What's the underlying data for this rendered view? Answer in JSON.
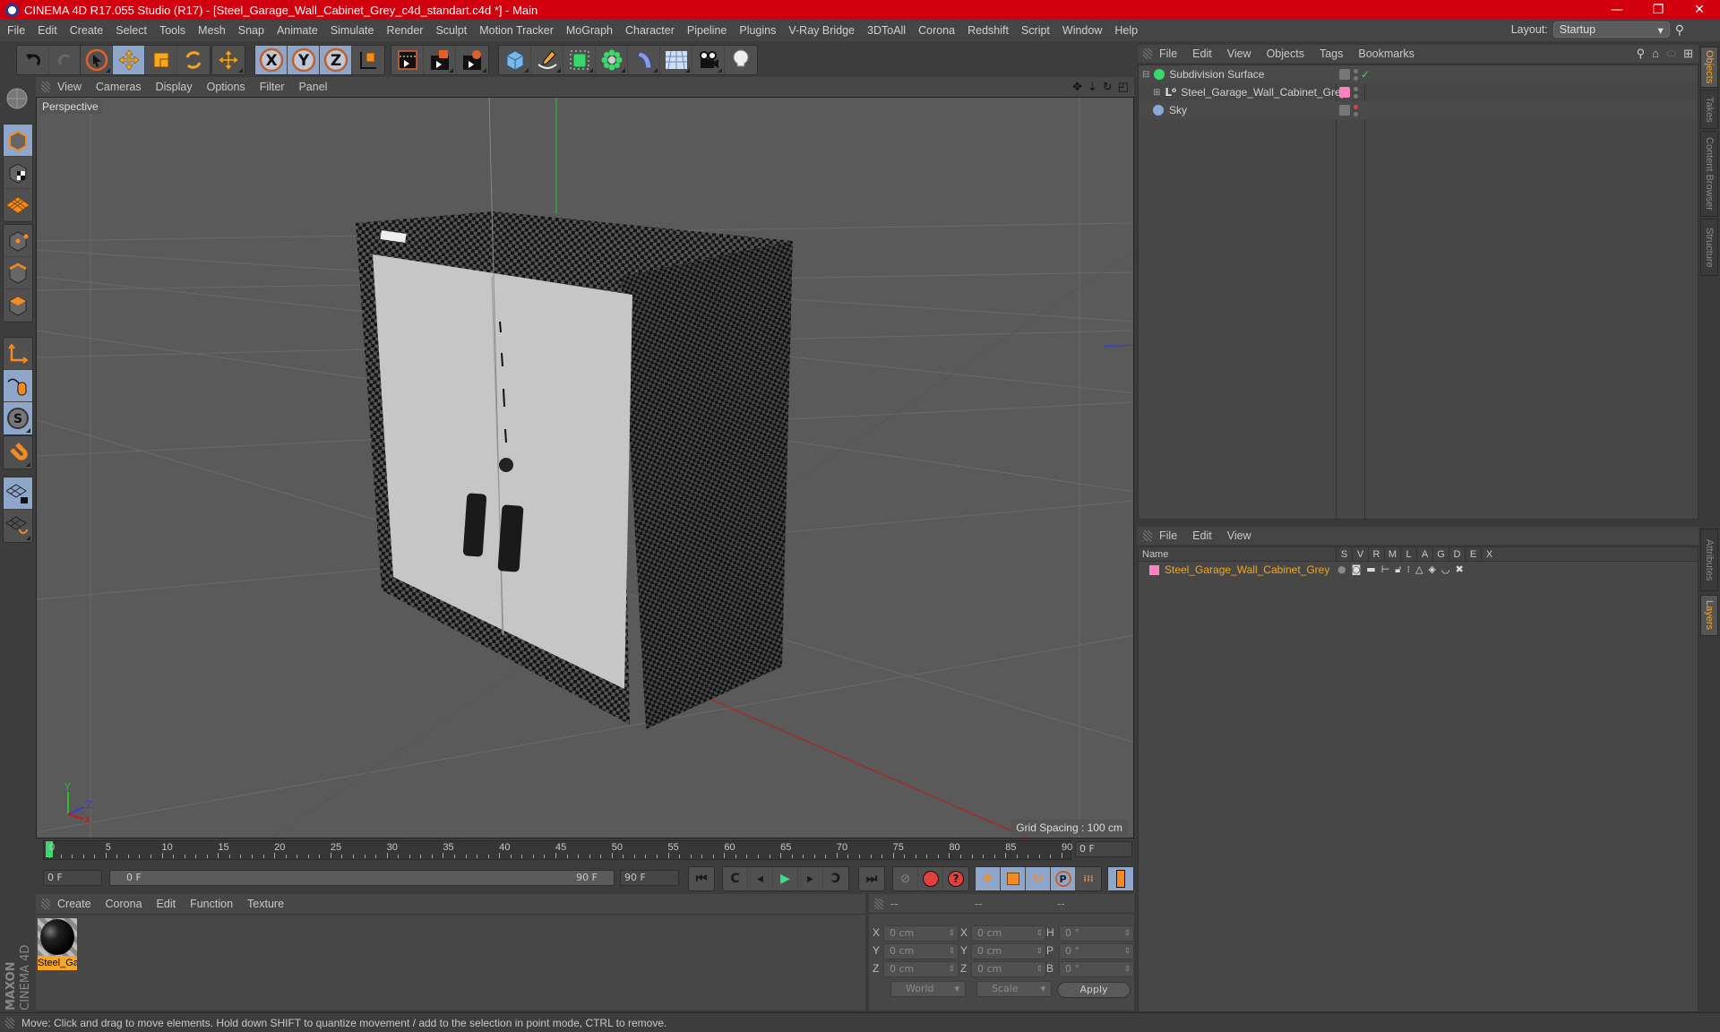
{
  "window": {
    "title": "CINEMA 4D R17.055 Studio (R17) - [Steel_Garage_Wall_Cabinet_Grey_c4d_standart.c4d *] - Main",
    "controls": [
      "minimize-icon",
      "maximize-icon",
      "close-icon"
    ]
  },
  "menubar": {
    "items": [
      "File",
      "Edit",
      "Create",
      "Select",
      "Tools",
      "Mesh",
      "Snap",
      "Animate",
      "Simulate",
      "Render",
      "Sculpt",
      "Motion Tracker",
      "MoGraph",
      "Character",
      "Pipeline",
      "Plugins",
      "V-Ray Bridge",
      "3DToAll",
      "Corona",
      "Redshift",
      "Script",
      "Window",
      "Help"
    ],
    "layout_label": "Layout:",
    "layout_value": "Startup"
  },
  "toolbar": {
    "groups": [
      [
        "undo-icon",
        "redo-icon"
      ],
      [
        "select-icon",
        "move-icon",
        "scale-icon",
        "rotate-icon"
      ],
      [
        "move-last-icon"
      ],
      [
        "x-axis-icon",
        "y-axis-icon",
        "z-axis-icon",
        "coordinate-system-icon"
      ],
      [
        "render-view-icon",
        "render-picture-viewer-icon",
        "render-settings-icon"
      ],
      [
        "cube-icon",
        "pen-icon",
        "subdivision-icon",
        "cloner-icon",
        "deformer-icon",
        "floor-icon",
        "camera-icon",
        "light-icon"
      ]
    ]
  },
  "left_tools": [
    "workplane-icon",
    "model-mode-icon",
    "texture-mode-icon",
    "workplane-grid-icon",
    "points-mode-icon",
    "edges-mode-icon",
    "polygons-mode-icon",
    "axis-icon",
    "tweak-icon",
    "soft-selection-icon",
    "snap-magnet-icon",
    "lock-workplane-icon",
    "workplane-rotate-icon"
  ],
  "viewport": {
    "menu": [
      "View",
      "Cameras",
      "Display",
      "Options",
      "Filter",
      "Panel"
    ],
    "nav_icons": [
      "pan-icon",
      "zoom-icon",
      "orbit-icon",
      "maximize-view-icon"
    ],
    "label": "Perspective",
    "grid_spacing": "Grid Spacing : 100 cm",
    "axis_labels": {
      "x": "X",
      "y": "Y",
      "z": "Z"
    }
  },
  "timeline": {
    "ticks": [
      0,
      5,
      10,
      15,
      20,
      25,
      30,
      35,
      40,
      45,
      50,
      55,
      60,
      65,
      70,
      75,
      80,
      85,
      90
    ],
    "current_frame": "0 F",
    "start_field": "0 F",
    "range_start": "0 F",
    "range_end": "90 F",
    "end_field": "90 F"
  },
  "transport": {
    "buttons": [
      "go-to-start-icon",
      "previous-key-icon",
      "step-back-icon",
      "play-icon",
      "step-forward-icon",
      "next-key-icon",
      "go-to-end-icon"
    ],
    "record": [
      "keyframe-selection-icon",
      "autokey-icon",
      "record-help-icon"
    ],
    "key_types": [
      "key-position-icon",
      "key-scale-icon",
      "key-rotation-icon",
      "key-parameter-icon",
      "key-point-level-icon"
    ],
    "timeline_icon": "timeline-icon"
  },
  "material_manager": {
    "menu": [
      "Create",
      "Corona",
      "Edit",
      "Function",
      "Texture"
    ],
    "materials": [
      {
        "name": "Steel_Ga"
      }
    ]
  },
  "coordinates": {
    "headers": [
      "--",
      "--",
      "--"
    ],
    "position": [
      {
        "axis": "X",
        "value": "0 cm"
      },
      {
        "axis": "Y",
        "value": "0 cm"
      },
      {
        "axis": "Z",
        "value": "0 cm"
      }
    ],
    "size": [
      {
        "axis": "X",
        "value": "0 cm"
      },
      {
        "axis": "Y",
        "value": "0 cm"
      },
      {
        "axis": "Z",
        "value": "0 cm"
      }
    ],
    "rotation": [
      {
        "axis": "H",
        "value": "0 °"
      },
      {
        "axis": "P",
        "value": "0 °"
      },
      {
        "axis": "B",
        "value": "0 °"
      }
    ],
    "space_dropdown": "World",
    "mode_dropdown": "Scale",
    "apply_label": "Apply"
  },
  "object_manager": {
    "menu": [
      "File",
      "Edit",
      "View",
      "Objects",
      "Tags",
      "Bookmarks"
    ],
    "objects": [
      {
        "name": "Subdivision Surface",
        "icon": "subdivision-surface-icon",
        "tag": "gray",
        "enabled": "check"
      },
      {
        "name": "Steel_Garage_Wall_Cabinet_Grey",
        "icon": "null-object-icon",
        "tag": "pink",
        "enabled": "dots"
      },
      {
        "name": "Sky",
        "icon": "sky-icon",
        "tag": "gray",
        "enabled": "red-dot"
      }
    ]
  },
  "layer_manager": {
    "menu": [
      "File",
      "Edit",
      "View"
    ],
    "columns": [
      "Name",
      "S",
      "V",
      "R",
      "M",
      "L",
      "A",
      "G",
      "D",
      "E",
      "X"
    ],
    "layers": [
      {
        "name": "Steel_Garage_Wall_Cabinet_Grey",
        "color": "#ff82c0"
      }
    ]
  },
  "right_tabs": {
    "top": [
      {
        "label": "Objects",
        "active": true
      },
      {
        "label": "Takes",
        "active": false
      },
      {
        "label": "Content Browser",
        "active": false
      },
      {
        "label": "Structure",
        "active": false
      }
    ],
    "bottom": [
      {
        "label": "Attributes",
        "active": false
      },
      {
        "label": "Layers",
        "active": true
      }
    ]
  },
  "status": {
    "text": "Move: Click and drag to move elements. Hold down SHIFT to quantize movement / add to the selection in point mode, CTRL to remove."
  },
  "brand": {
    "maxon": "MAXON",
    "product": "CINEMA 4D"
  },
  "colors": {
    "titlebar": "#d2000f",
    "accent_orange": "#f5a623",
    "active_blue": "#8ea6c9",
    "layer_pink": "#ff82c0"
  }
}
